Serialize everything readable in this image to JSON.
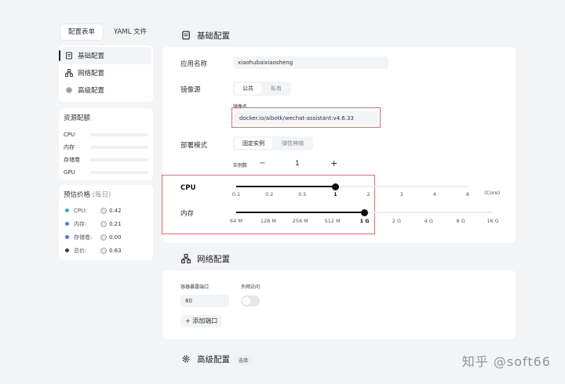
{
  "left": {
    "tabs": [
      {
        "label": "配置表单",
        "active": true
      },
      {
        "label": "YAML 文件",
        "active": false
      }
    ],
    "nav": [
      {
        "label": "基础配置",
        "icon": "document-icon",
        "active": true
      },
      {
        "label": "网络配置",
        "icon": "network-icon",
        "active": false
      },
      {
        "label": "高级配置",
        "icon": "gear-icon",
        "active": false
      }
    ],
    "resources": {
      "title": "资源配额",
      "rows": [
        {
          "label": "CPU"
        },
        {
          "label": "内存"
        },
        {
          "label": "存储卷"
        },
        {
          "label": "GPU"
        }
      ]
    },
    "price": {
      "title": "预估价格",
      "subtitle": "(每日)",
      "rows": [
        {
          "label": "CPU:",
          "value": "0.42",
          "color": "#2cb5a5"
        },
        {
          "label": "内存:",
          "value": "0.21",
          "color": "#3b82f6"
        },
        {
          "label": "存储卷:",
          "value": "0.00",
          "color": "#6366f1"
        },
        {
          "label": "总价:",
          "value": "0.63",
          "color": "#374151"
        }
      ]
    }
  },
  "basic": {
    "title": "基础配置",
    "app_name_label": "应用名称",
    "app_name_value": "xiaohubaixiaosheng",
    "image_source_label": "镜像源",
    "image_source_options": [
      {
        "label": "公共",
        "active": true
      },
      {
        "label": "私有",
        "active": false
      }
    ],
    "image_name_label": "镜像名",
    "image_name_value": "docker.io/aibotk/wechat-assistant:v4.6.33",
    "deploy_mode_label": "部署模式",
    "deploy_mode_options": [
      {
        "label": "固定实例",
        "active": true
      },
      {
        "label": "弹性伸缩",
        "active": false
      }
    ],
    "instances_label": "实例数",
    "instances_minus": "−",
    "instances_value": "1",
    "instances_plus": "+",
    "cpu_label": "CPU",
    "cpu_ticks": [
      "0.1",
      "0.2",
      "0.5",
      "1",
      "2",
      "3",
      "4",
      "8"
    ],
    "cpu_selected_index": 3,
    "cpu_unit": "(Core)",
    "mem_label": "内存",
    "mem_ticks": [
      "64 M",
      "128 M",
      "256 M",
      "512 M",
      "1 G",
      "2 G",
      "4 G",
      "8 G",
      "16 G"
    ],
    "mem_selected_index": 4
  },
  "network": {
    "title": "网络配置",
    "port_label": "容器暴露端口",
    "port_value": "80",
    "external_label": "外网访问",
    "external_enabled": false,
    "add_port_label": "添加端口"
  },
  "advanced": {
    "title": "高级配置",
    "badge": "选填"
  },
  "watermark": "知乎 @soft66"
}
